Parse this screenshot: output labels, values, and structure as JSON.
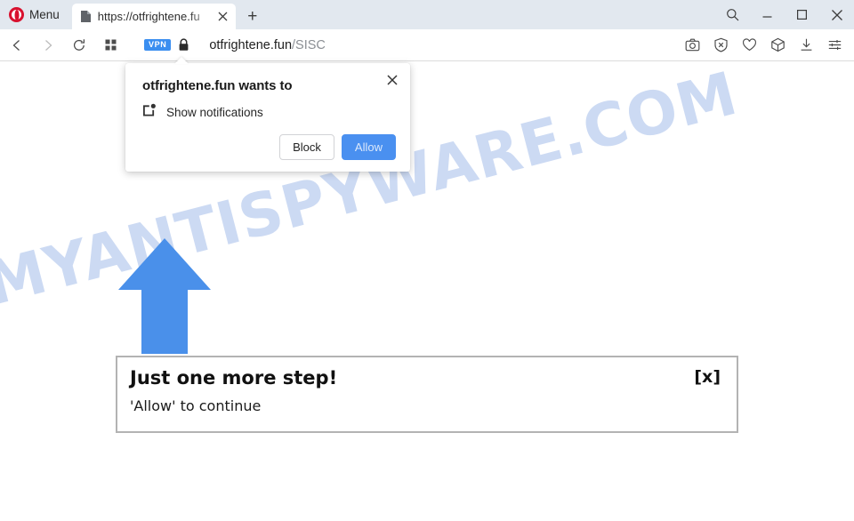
{
  "browser": {
    "name": "Opera",
    "menu_label": "Menu",
    "tab": {
      "title": "https://otfrightene.fu",
      "favicon": "page-icon",
      "close_glyph": "✕"
    },
    "new_tab_glyph": "+",
    "window_controls": {
      "search": "search-icon",
      "minimize": "_",
      "maximize": "▢",
      "close": "✕"
    },
    "nav": {
      "back": "‹",
      "forward": "›",
      "reload": "⟳",
      "speed_dial": "grid-icon"
    },
    "address": {
      "vpn_badge": "VPN",
      "lock": "lock-icon",
      "host": "otfrightene.fun",
      "path": "/SISC"
    },
    "toolbar_icons": [
      {
        "name": "snapshot-icon"
      },
      {
        "name": "ad-blocker-icon"
      },
      {
        "name": "heart-icon"
      },
      {
        "name": "crypto-wallet-icon"
      },
      {
        "name": "downloads-icon"
      },
      {
        "name": "easy-setup-icon"
      }
    ]
  },
  "permission_dialog": {
    "title": "otfrightene.fun wants to",
    "item_icon": "notification-icon",
    "item_label": "Show notifications",
    "block_label": "Block",
    "allow_label": "Allow",
    "close_glyph": "✕",
    "allow_color": "#4a90f0"
  },
  "page": {
    "watermark": "MYANTISPYWARE.COM",
    "watermark_color": "#ccdaf3",
    "arrow": {
      "name": "blue-up-arrow",
      "color": "#4a90ea"
    },
    "content_box": {
      "title": "Just one more step!",
      "subtitle": "'Allow' to continue",
      "close_label": "[x]"
    }
  }
}
